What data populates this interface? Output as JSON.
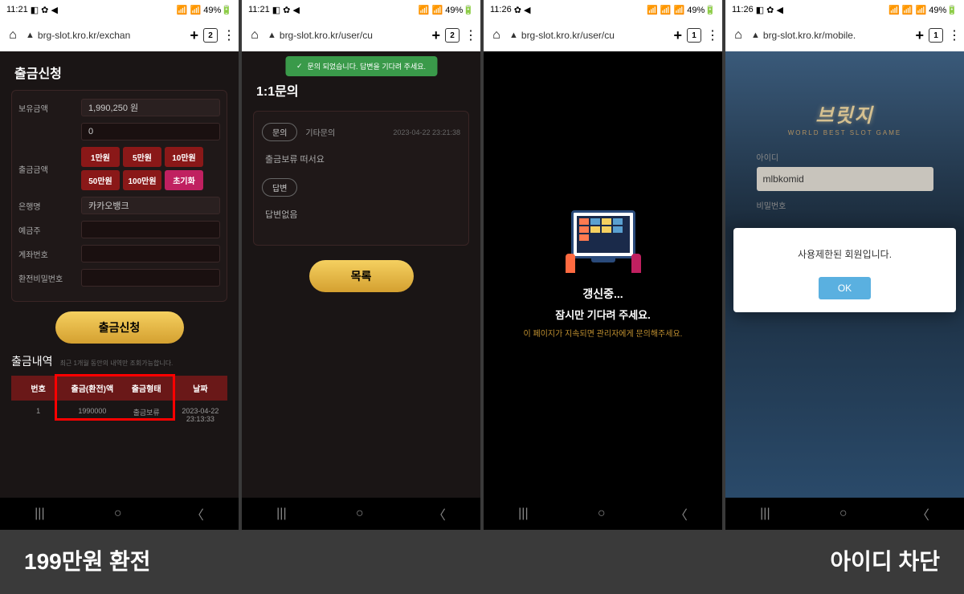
{
  "status": {
    "time1": "11:21",
    "time2": "11:26",
    "icons_left": "◧ ✿ ◀",
    "icons_right": "📶 📶 49%🔋",
    "icons_right_alt": "📶 📶 📶 49%🔋"
  },
  "browser": {
    "url1": "brg-slot.kro.kr/exchan",
    "url2": "brg-slot.kro.kr/user/cu",
    "url3": "brg-slot.kro.kr/user/cu",
    "url4": "brg-slot.kro.kr/mobile.",
    "tabs_a": "2",
    "tabs_b": "1"
  },
  "s1": {
    "title": "출금신청",
    "balance_label": "보유금액",
    "balance_value": "1,990,250 원",
    "amount_label": "출금금액",
    "amount_value": "0",
    "btn_1": "1만원",
    "btn_5": "5만원",
    "btn_10": "10만원",
    "btn_50": "50만원",
    "btn_100": "100만원",
    "btn_reset": "초기화",
    "bank_label": "은행명",
    "bank_value": "카카오뱅크",
    "holder_label": "예금주",
    "account_label": "계좌번호",
    "pwd_label": "환전비밀번호",
    "submit": "출금신청",
    "history_title": "출금내역",
    "history_sub": "최근 1개월 동안의 내역만 조회가능합니다.",
    "th_no": "번호",
    "th_amount": "출금(환전)액",
    "th_status": "출금형태",
    "th_date": "날짜",
    "td_no": "1",
    "td_amount": "1990000",
    "td_status": "출금보류",
    "td_date": "2023-04-22 23:13:33"
  },
  "s2": {
    "toast": "문의 되었습니다. 답변을 기다려 주세요.",
    "title": "1:1문의",
    "badge": "문의",
    "category": "기타문의",
    "date": "2023-04-22 23:21:38",
    "msg": "출금보류 떠서요",
    "reply_badge": "답변",
    "reply_none": "답변없음",
    "list_btn": "목록"
  },
  "s3": {
    "loading": "갱신중...",
    "wait": "잠시만 기다려 주세요.",
    "note": "이 페이지가 지속되면 관리자에게 문의해주세요."
  },
  "s4": {
    "logo": "브릿지",
    "sub": "WORLD BEST SLOT GAME",
    "id_label": "아이디",
    "id_value": "mlbkomid",
    "pw_label": "비밀번호",
    "modal_text": "사용제한된 회원입니다.",
    "modal_btn": "OK"
  },
  "captions": {
    "left": "199만원 환전",
    "right": "아이디 차단"
  }
}
